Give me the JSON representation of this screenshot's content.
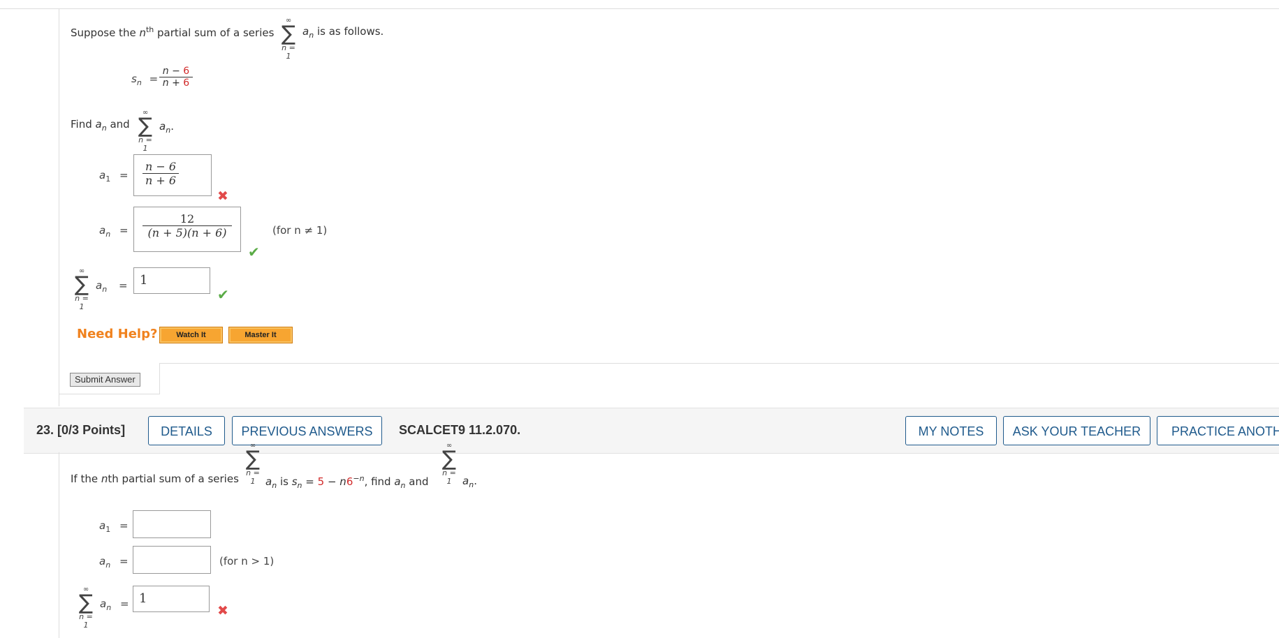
{
  "q22": {
    "intro_pre": "Suppose the ",
    "intro_n": "n",
    "intro_sup": "th",
    "intro_mid": " partial sum of a series ",
    "intro_post": " is as follows.",
    "sigma": "∑",
    "sigma_top": "∞",
    "sigma_bottom": "n = 1",
    "a_n": "a",
    "sub_n": "n",
    "sn_label": "s",
    "equals": "=",
    "sn_num_n": "n − ",
    "sn_num_c": "6",
    "sn_den_n": "n + ",
    "sn_den_c": "6",
    "find_pre": "Find ",
    "find_mid": " and ",
    "find_post": ".",
    "a1_label": "a",
    "a1_sub": "1",
    "a1_answer_num": "n − 6",
    "a1_answer_den": "n + 6",
    "an_answer_num": "12",
    "an_answer_den": "(n + 5)(n + 6)",
    "an_condition": "(for n ≠ 1)",
    "sum_answer": "1",
    "need_help": "Need Help?",
    "watch_it": "Watch It",
    "master_it": "Master It",
    "submit": "Submit Answer"
  },
  "q23": {
    "number": "23.",
    "points": "[0/3 Points]",
    "details": "DETAILS",
    "previous_answers": "PREVIOUS ANSWERS",
    "code": "SCALCET9 11.2.070.",
    "my_notes": "MY NOTES",
    "ask_teacher": "ASK YOUR TEACHER",
    "practice_another": "PRACTICE ANOTHER",
    "intro_pre": "If the ",
    "intro_n": "n",
    "intro_mid": "th partial sum of a series ",
    "intro_is": " is ",
    "sn_eq": " = ",
    "sn_5": "5",
    "sn_minus": " − n",
    "sn_6": "6",
    "sn_exp": "−n",
    "intro_find": ", find ",
    "intro_and": " and ",
    "intro_end": ".",
    "a1_value": "",
    "an_value": "",
    "an_condition": "(for n > 1)",
    "sum_value": "1"
  },
  "colors": {
    "accent_blue": "#1f5a8c",
    "help_orange": "#f0821e",
    "correct_green": "#5aab46",
    "incorrect_red": "#e24a4a",
    "highlight_red": "#d12a2a"
  }
}
